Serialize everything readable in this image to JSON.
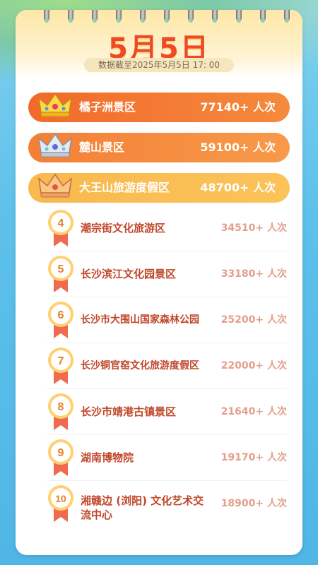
{
  "header": {
    "title": "5月5日",
    "subtitle": "数据截至2025年5月5日 17: 00"
  },
  "colors": {
    "accent": "#ef4a23",
    "rank1": "#f26a2b",
    "rank2": "#f47f36",
    "rank3": "#f8b94e",
    "rank_text": "#c0462a",
    "count_text": "#e3a08a"
  },
  "top_rankings": [
    {
      "rank": 1,
      "icon": "gold-crown-icon",
      "name": "橘子洲景区",
      "count": "77140+ 人次"
    },
    {
      "rank": 2,
      "icon": "silver-crown-icon",
      "name": "麓山景区",
      "count": "59100+ 人次"
    },
    {
      "rank": 3,
      "icon": "bronze-crown-icon",
      "name": "大王山旅游度假区",
      "count": "48700+ 人次"
    }
  ],
  "rankings": [
    {
      "rank": "4",
      "icon": "medal-ribbon-icon",
      "name": "潮宗街文化旅游区",
      "count": "34510+ 人次"
    },
    {
      "rank": "5",
      "icon": "medal-ribbon-icon",
      "name": "长沙滨江文化园景区",
      "count": "33180+ 人次"
    },
    {
      "rank": "6",
      "icon": "medal-ribbon-icon",
      "name": "长沙市大围山国家森林公园",
      "count": "25200+ 人次"
    },
    {
      "rank": "7",
      "icon": "medal-ribbon-icon",
      "name": "长沙铜官窑文化旅游度假区",
      "count": "22000+ 人次"
    },
    {
      "rank": "8",
      "icon": "medal-ribbon-icon",
      "name": "长沙市靖港古镇景区",
      "count": "21640+ 人次"
    },
    {
      "rank": "9",
      "icon": "medal-ribbon-icon",
      "name": "湖南博物院",
      "count": "19170+ 人次"
    },
    {
      "rank": "10",
      "icon": "medal-ribbon-icon",
      "name": "湘赣边 (浏阳) 文化艺术交流中心",
      "count": "18900+ 人次"
    }
  ]
}
